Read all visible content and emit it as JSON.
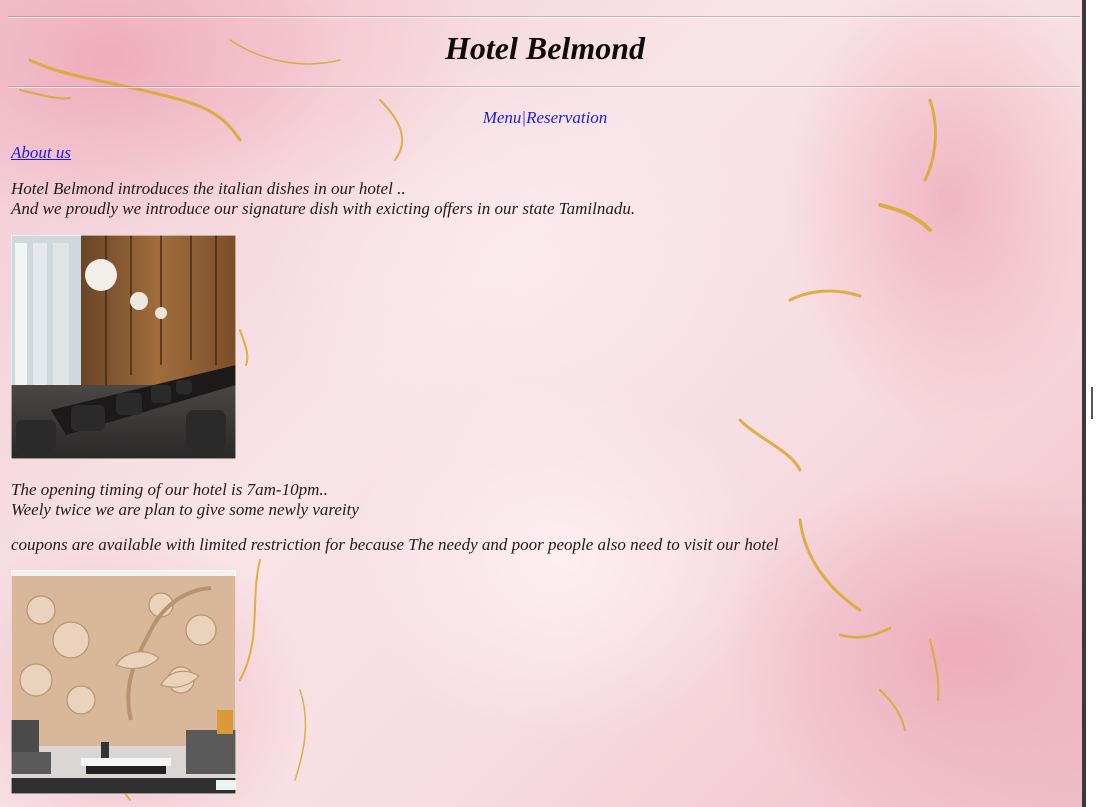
{
  "header": {
    "title": "Hotel Belmond"
  },
  "nav": {
    "menu_label": "Menu",
    "separator": "|",
    "reservation_label": "Reservation"
  },
  "about_link": "About us",
  "intro": {
    "line1": "Hotel Belmond introduces the italian dishes in our hotel ..",
    "line2": "And we proudly we introduce our signature dish with exicting offers in our state Tamilnadu."
  },
  "images": {
    "restaurant": "restaurant-interior-photo",
    "lounge": "floral-relief-lounge-photo"
  },
  "timing": {
    "line1": "The opening timing of our hotel is 7am-10pm..",
    "line2": "Weely twice we are plan to give some newly vareity"
  },
  "coupons": "coupons are available with limited restriction for because The needy and poor people also need to visit our hotel",
  "colors": {
    "link": "#1c1cdc",
    "background": "#f6dfe3",
    "gold": "#d9a92e"
  }
}
